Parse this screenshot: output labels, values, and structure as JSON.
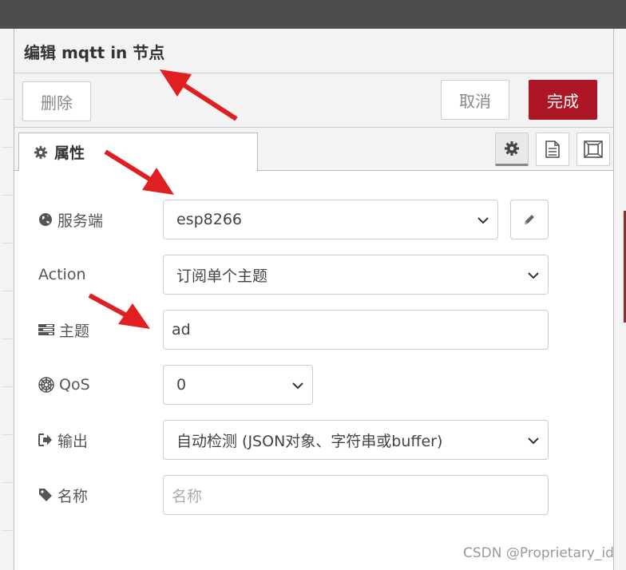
{
  "dialog": {
    "title": "编辑 mqtt in 节点"
  },
  "toolbar": {
    "delete_label": "删除",
    "cancel_label": "取消",
    "done_label": "完成"
  },
  "tabs": {
    "properties_label": "属性"
  },
  "form": {
    "server": {
      "label": "服务端",
      "value": "esp8266"
    },
    "action": {
      "label": "Action",
      "value": "订阅单个主题"
    },
    "topic": {
      "label": "主题",
      "value": "ad"
    },
    "qos": {
      "label": "QoS",
      "value": "0"
    },
    "output": {
      "label": "输出",
      "value": "自动检测 (JSON对象、字符串或buffer)"
    },
    "name": {
      "label": "名称",
      "placeholder": "名称"
    }
  },
  "watermark": "CSDN @Proprietary_id",
  "colors": {
    "done_button": "#ad1625",
    "topbar": "#4d4d4d",
    "annotation_arrow": "#e02020"
  }
}
